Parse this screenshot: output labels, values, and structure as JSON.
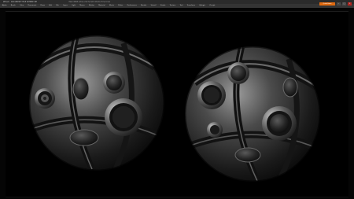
{
  "window": {
    "title": "ZBrush  ·  DOCUMENT TITLE SPHERE SET",
    "doc_info": "Mem 8058  Active 210  Scratch  Points  Time  Undo"
  },
  "menubar": {
    "items": [
      "Alpha",
      "Brush",
      "Color",
      "Document",
      "Draw",
      "Edit",
      "File",
      "Layer",
      "Light",
      "Macro",
      "Marker",
      "Material",
      "Movie",
      "Picker",
      "Preferences",
      "Render",
      "Stencil",
      "Stroke",
      "Texture",
      "Tool",
      "Transform",
      "Zplugin",
      "Zscript"
    ]
  },
  "controls": {
    "quicksave": "QuickSave",
    "minimize": "–",
    "maximize": "□",
    "close": "×"
  },
  "colors": {
    "accent": "#e06a10",
    "background": "#000000"
  }
}
